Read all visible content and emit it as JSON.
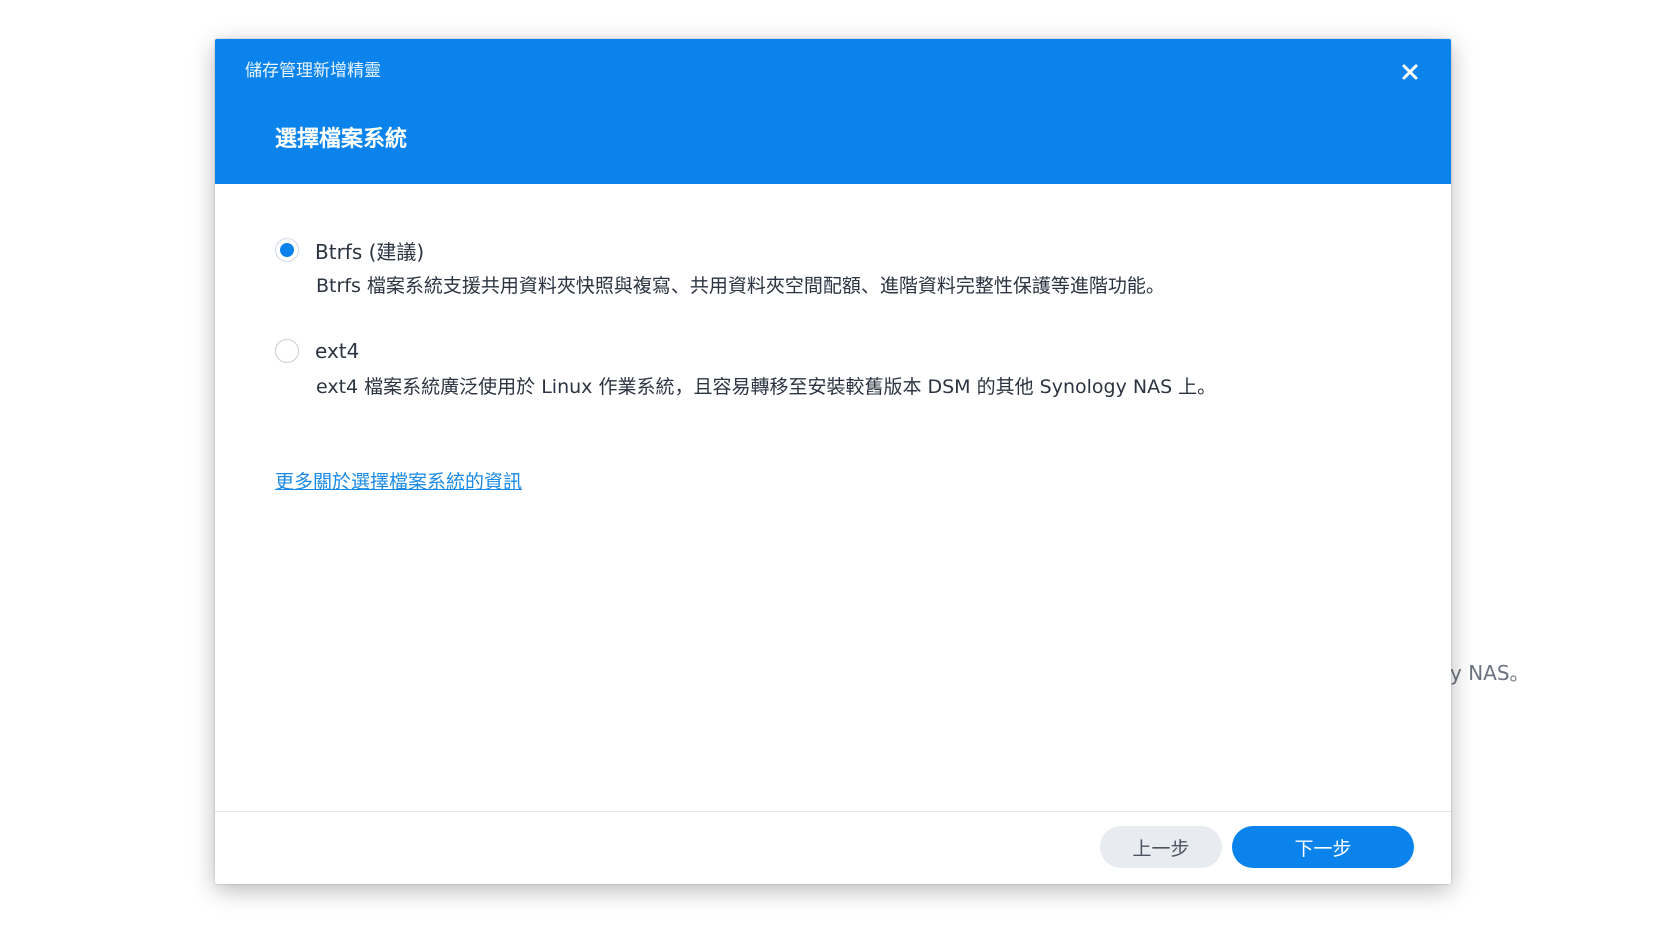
{
  "background": {
    "partial_text": "y NAS。"
  },
  "dialog": {
    "window_title": "儲存管理新增精靈",
    "step_title": "選擇檔案系統",
    "close_icon": "close-icon",
    "options": [
      {
        "label": "Btrfs (建議)",
        "checked": true,
        "description": "Btrfs 檔案系統支援共用資料夾快照與複寫、共用資料夾空間配額、進階資料完整性保護等進階功能。"
      },
      {
        "label": "ext4",
        "checked": false,
        "description": "ext4 檔案系統廣泛使用於 Linux 作業系統，且容易轉移至安裝較舊版本 DSM 的其他 Synology NAS 上。"
      }
    ],
    "more_info_link": "更多關於選擇檔案系統的資訊",
    "buttons": {
      "previous": "上一步",
      "next": "下一步"
    }
  },
  "colors": {
    "accent": "#0a84ec",
    "text": "#2b3440",
    "link": "#1a8ae6"
  }
}
